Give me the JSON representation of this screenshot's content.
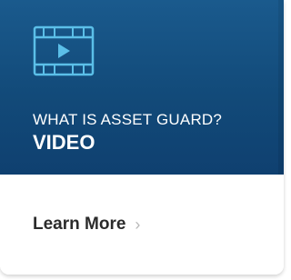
{
  "card": {
    "eyebrow": "WHAT IS ASSET GUARD?",
    "title": "VIDEO",
    "cta_label": "Learn More",
    "icon": "video-player-icon",
    "chevron_icon": "chevron-right-icon",
    "colors": {
      "hero_background": "#124a79",
      "icon_stroke": "#5bbfe8",
      "cta_text": "#2b2b2b",
      "chevron": "#b8b8b8"
    }
  }
}
